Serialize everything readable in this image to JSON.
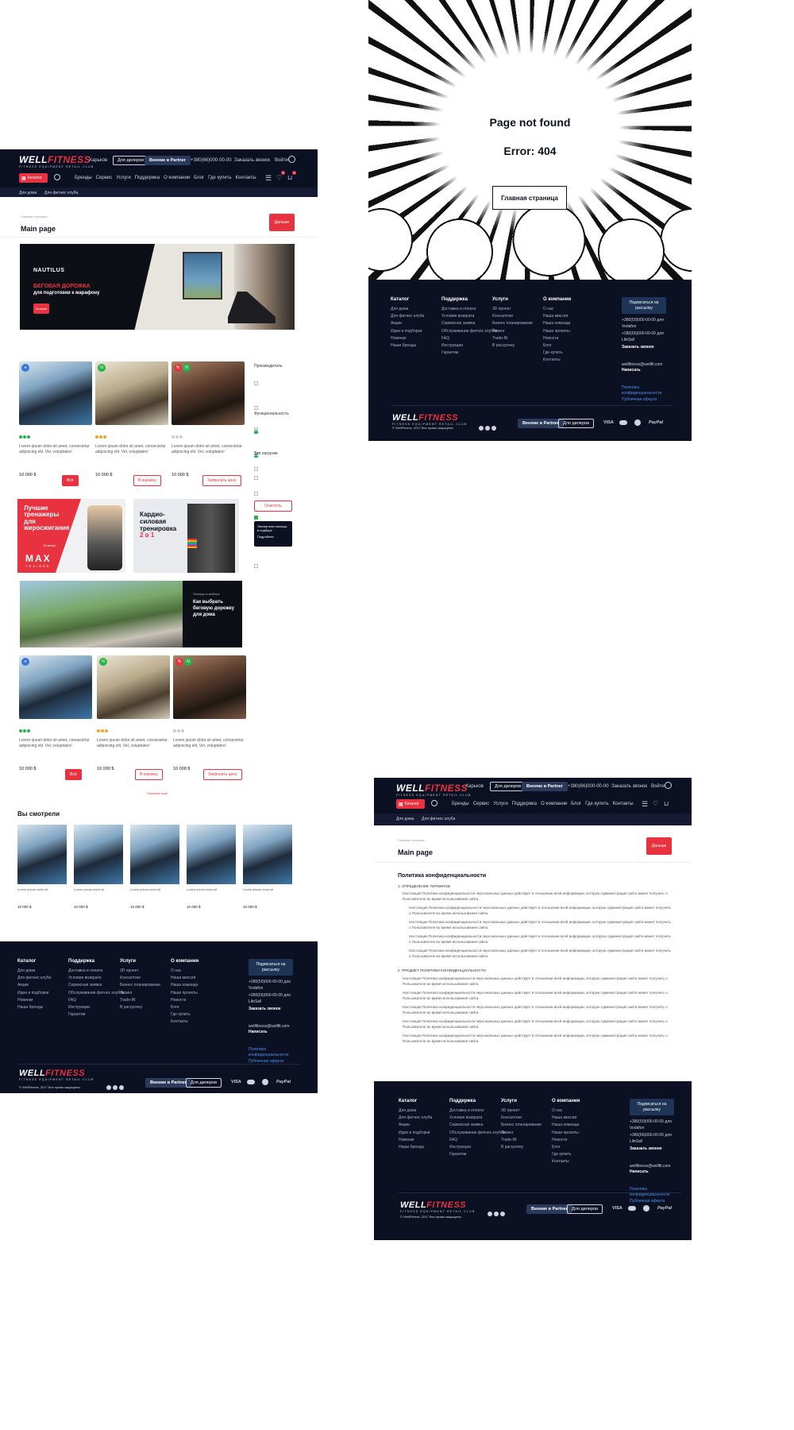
{
  "header": {
    "logo_main": "WELL",
    "logo_accent": "FITNESS",
    "logo_sub": "FITNESS EQUIPMENT RETAIL CLUB",
    "city": "Харьков",
    "dealers_btn": "Для дилеров",
    "partner_btn": "Веееме в Partner",
    "phone": "+380(66)000-00-00",
    "callback": "Заказать звонок",
    "login": "Войти",
    "catalog_btn": "Каталог",
    "nav": [
      "Бренды",
      "Сервис",
      "Услуги",
      "Поддержка",
      "О компании",
      "Блог",
      "Где купить",
      "Контакты"
    ],
    "subnav": [
      "Для дома",
      "Для фитнес клуба"
    ],
    "wish_count": "0",
    "cart_count": "0"
  },
  "main_page": {
    "breadcrumb": "Главная страница",
    "title": "Main page",
    "more_btn": "Дальше",
    "hero": {
      "brand": "NAUTILUS",
      "line1": "БЕГОВАЯ ДОРОЖКА",
      "line2": "для подготовки к марафону",
      "btn": "Больше"
    },
    "products": [
      {
        "desc": "Lorem ipsum dolor sit amet, consectetur adipiscing elit. Vel, voluptates!",
        "price": "10 000 $",
        "btn": "Всё"
      },
      {
        "desc": "Lorem ipsum dolor sit amet, consectetur adipiscing elit. Vel, voluptates!",
        "price": "10 000 $",
        "btn": "В корзину"
      },
      {
        "desc": "Lorem ipsum dolor sit amet, consectetur adipiscing elit. Vel, voluptates!",
        "price": "10 000 $",
        "btn": "Запросить цену"
      }
    ],
    "filter": {
      "group1_title": "Производитель",
      "group2_title": "Функциональность",
      "group3_title": "Тип нагрузки",
      "clear_btn": "Очистить",
      "expert_title": "Экспертная помощь в подборе",
      "expert_btn": "Подробнее"
    },
    "promo1": {
      "l1": "Лучшие",
      "l2": "тренажеры",
      "l3": "для",
      "l4": "жиросжигания",
      "brand": "MAX",
      "brand_sub": "TRAINER",
      "small": "14 минут"
    },
    "promo2": {
      "l1": "Кардио-",
      "l2": "силовая",
      "l3": "тренировка",
      "l4": "2 в 1"
    },
    "promo3": {
      "small": "Помощь в выборе",
      "l1": "Как выбрать",
      "l2": "беговую дорожку",
      "l3": "для дома"
    },
    "show_more": "Показать ещё",
    "viewed_title": "Вы смотрели",
    "viewed_item_desc": "Lorem ipsum dolor sit",
    "viewed_price": "10 000 $"
  },
  "footer": {
    "cols": [
      {
        "h": "Каталог",
        "items": [
          "Для дома",
          "Для фитнес клуба",
          "Акции",
          "Идеи и подборки",
          "Новинки",
          "Наши бренды"
        ]
      },
      {
        "h": "Поддержка",
        "items": [
          "Доставка и оплата",
          "Условия возврата",
          "Сервисная заявка",
          "Обслуживание фитнес клубов",
          "FAQ",
          "Инструкции",
          "Гарантии"
        ]
      },
      {
        "h": "Услуги",
        "items": [
          "3D проект",
          "Консалтинг",
          "Бизнес планирование",
          "Лизинг",
          "Trade-IN",
          "В рассрочку"
        ]
      },
      {
        "h": "О компании",
        "items": [
          "О нас",
          "Наша миссия",
          "Наша команда",
          "Наши проекты",
          "Новости",
          "Блог",
          "Где купить",
          "Контакты"
        ]
      }
    ],
    "subscribe": "Подписаться на рассылку",
    "phone1": "+380(50)000-00-00 для Vodafon",
    "phone2": "+380(66)000-00-00 для LifeSell",
    "callback": "Заказать звонок",
    "email": "wellfitness@wellfit.com",
    "write": "Написать",
    "privacy": "Политика конфиденциальности",
    "offer": "Публичная оферта",
    "copyright": "© WellFitness, 2017 Все права защищены",
    "partner_btn": "Веееме в Partner",
    "dealers_btn": "Для дилеров",
    "pay": [
      "VISA",
      "PayPal"
    ]
  },
  "error_page": {
    "title": "Page not found",
    "code": "Error: 404",
    "btn": "Главная страница"
  },
  "policy_page": {
    "breadcrumb": "Главная страница",
    "title": "Main page",
    "heading": "Политика конфиденциальности",
    "s1": "1. ОПРЕДЕЛЕНИЕ ТЕРМИНОВ",
    "s2": "2. ПРЕДМЕТ ПОЛИТИКИ КОНФИДЕНЦИАЛЬНОСТИ",
    "lorem": "Настоящая Политика конфиденциальности персональных данных действует в отношении всей информации, которую Администрация сайта может получить о Пользователе во время использования сайта."
  }
}
